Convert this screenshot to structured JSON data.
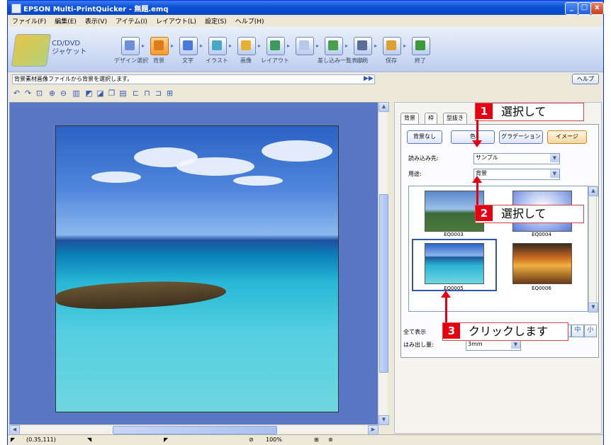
{
  "window": {
    "title": "EPSON Multi-PrintQuicker - 無題.emq",
    "minimize_label": "_",
    "maximize_label": "□",
    "close_label": "x"
  },
  "menu": [
    "ファイル(F)",
    "編集(E)",
    "表示(V)",
    "アイテム(I)",
    "レイアウト(L)",
    "設定(S)",
    "ヘルプ(H)"
  ],
  "toolbar": {
    "product_line1": "CD/DVD",
    "product_line2": "ジャケット",
    "steps": [
      {
        "label": "デザイン選択",
        "icon": "pencil-icon",
        "color": "#6b8fd9"
      },
      {
        "label": "背景",
        "icon": "brush-icon",
        "color": "#e07a20"
      },
      {
        "label": "文字",
        "icon": "text-a-icon",
        "color": "#4a7ad9"
      },
      {
        "label": "イラスト",
        "icon": "illustration-icon",
        "color": "#48a8c8"
      },
      {
        "label": "画像",
        "icon": "hand-image-icon",
        "color": "#e8b030"
      },
      {
        "label": "レイアウト",
        "icon": "layout-icon",
        "color": "#3c9a5a"
      },
      {
        "label": "",
        "icon": "frame-icon",
        "color": "#b8c8e8"
      },
      {
        "label": "差し込み一覧表示",
        "icon": "list-icon",
        "color": "#4aa04a"
      },
      {
        "label": "印刷",
        "icon": "printer-icon",
        "color": "#5a6e9a"
      },
      {
        "label": "保存",
        "icon": "save-folder-icon",
        "color": "#e0a030"
      },
      {
        "label": "終了",
        "icon": "exit-icon",
        "color": "#3a9a3a"
      }
    ]
  },
  "hint": {
    "text": "背景素材画像ファイルから背景を選択します。",
    "help_label": "ヘルプ"
  },
  "panel": {
    "tabs": [
      "背景",
      "枠",
      "型抜き"
    ],
    "buttons": [
      "背景なし",
      "色",
      "グラデーション",
      "イメージ"
    ],
    "source_label": "読み込み先:",
    "source_value": "サンプル",
    "usage_label": "用途:",
    "usage_value": "背景",
    "thumbnails": [
      "EQ0003",
      "EQ0004",
      "EQ0005",
      "EQ0006"
    ],
    "size_buttons": [
      "大",
      "中",
      "小"
    ],
    "show_all_label": "全て表示",
    "bleed_label": "はみ出し量:",
    "bleed_value": "3mm"
  },
  "callouts": [
    {
      "number": "1",
      "text": "選択して"
    },
    {
      "number": "2",
      "text": "選択して"
    },
    {
      "number": "3",
      "text": "クリックします"
    }
  ],
  "statusbar": {
    "coords": "(0.35,111)",
    "zoom": "100%"
  }
}
